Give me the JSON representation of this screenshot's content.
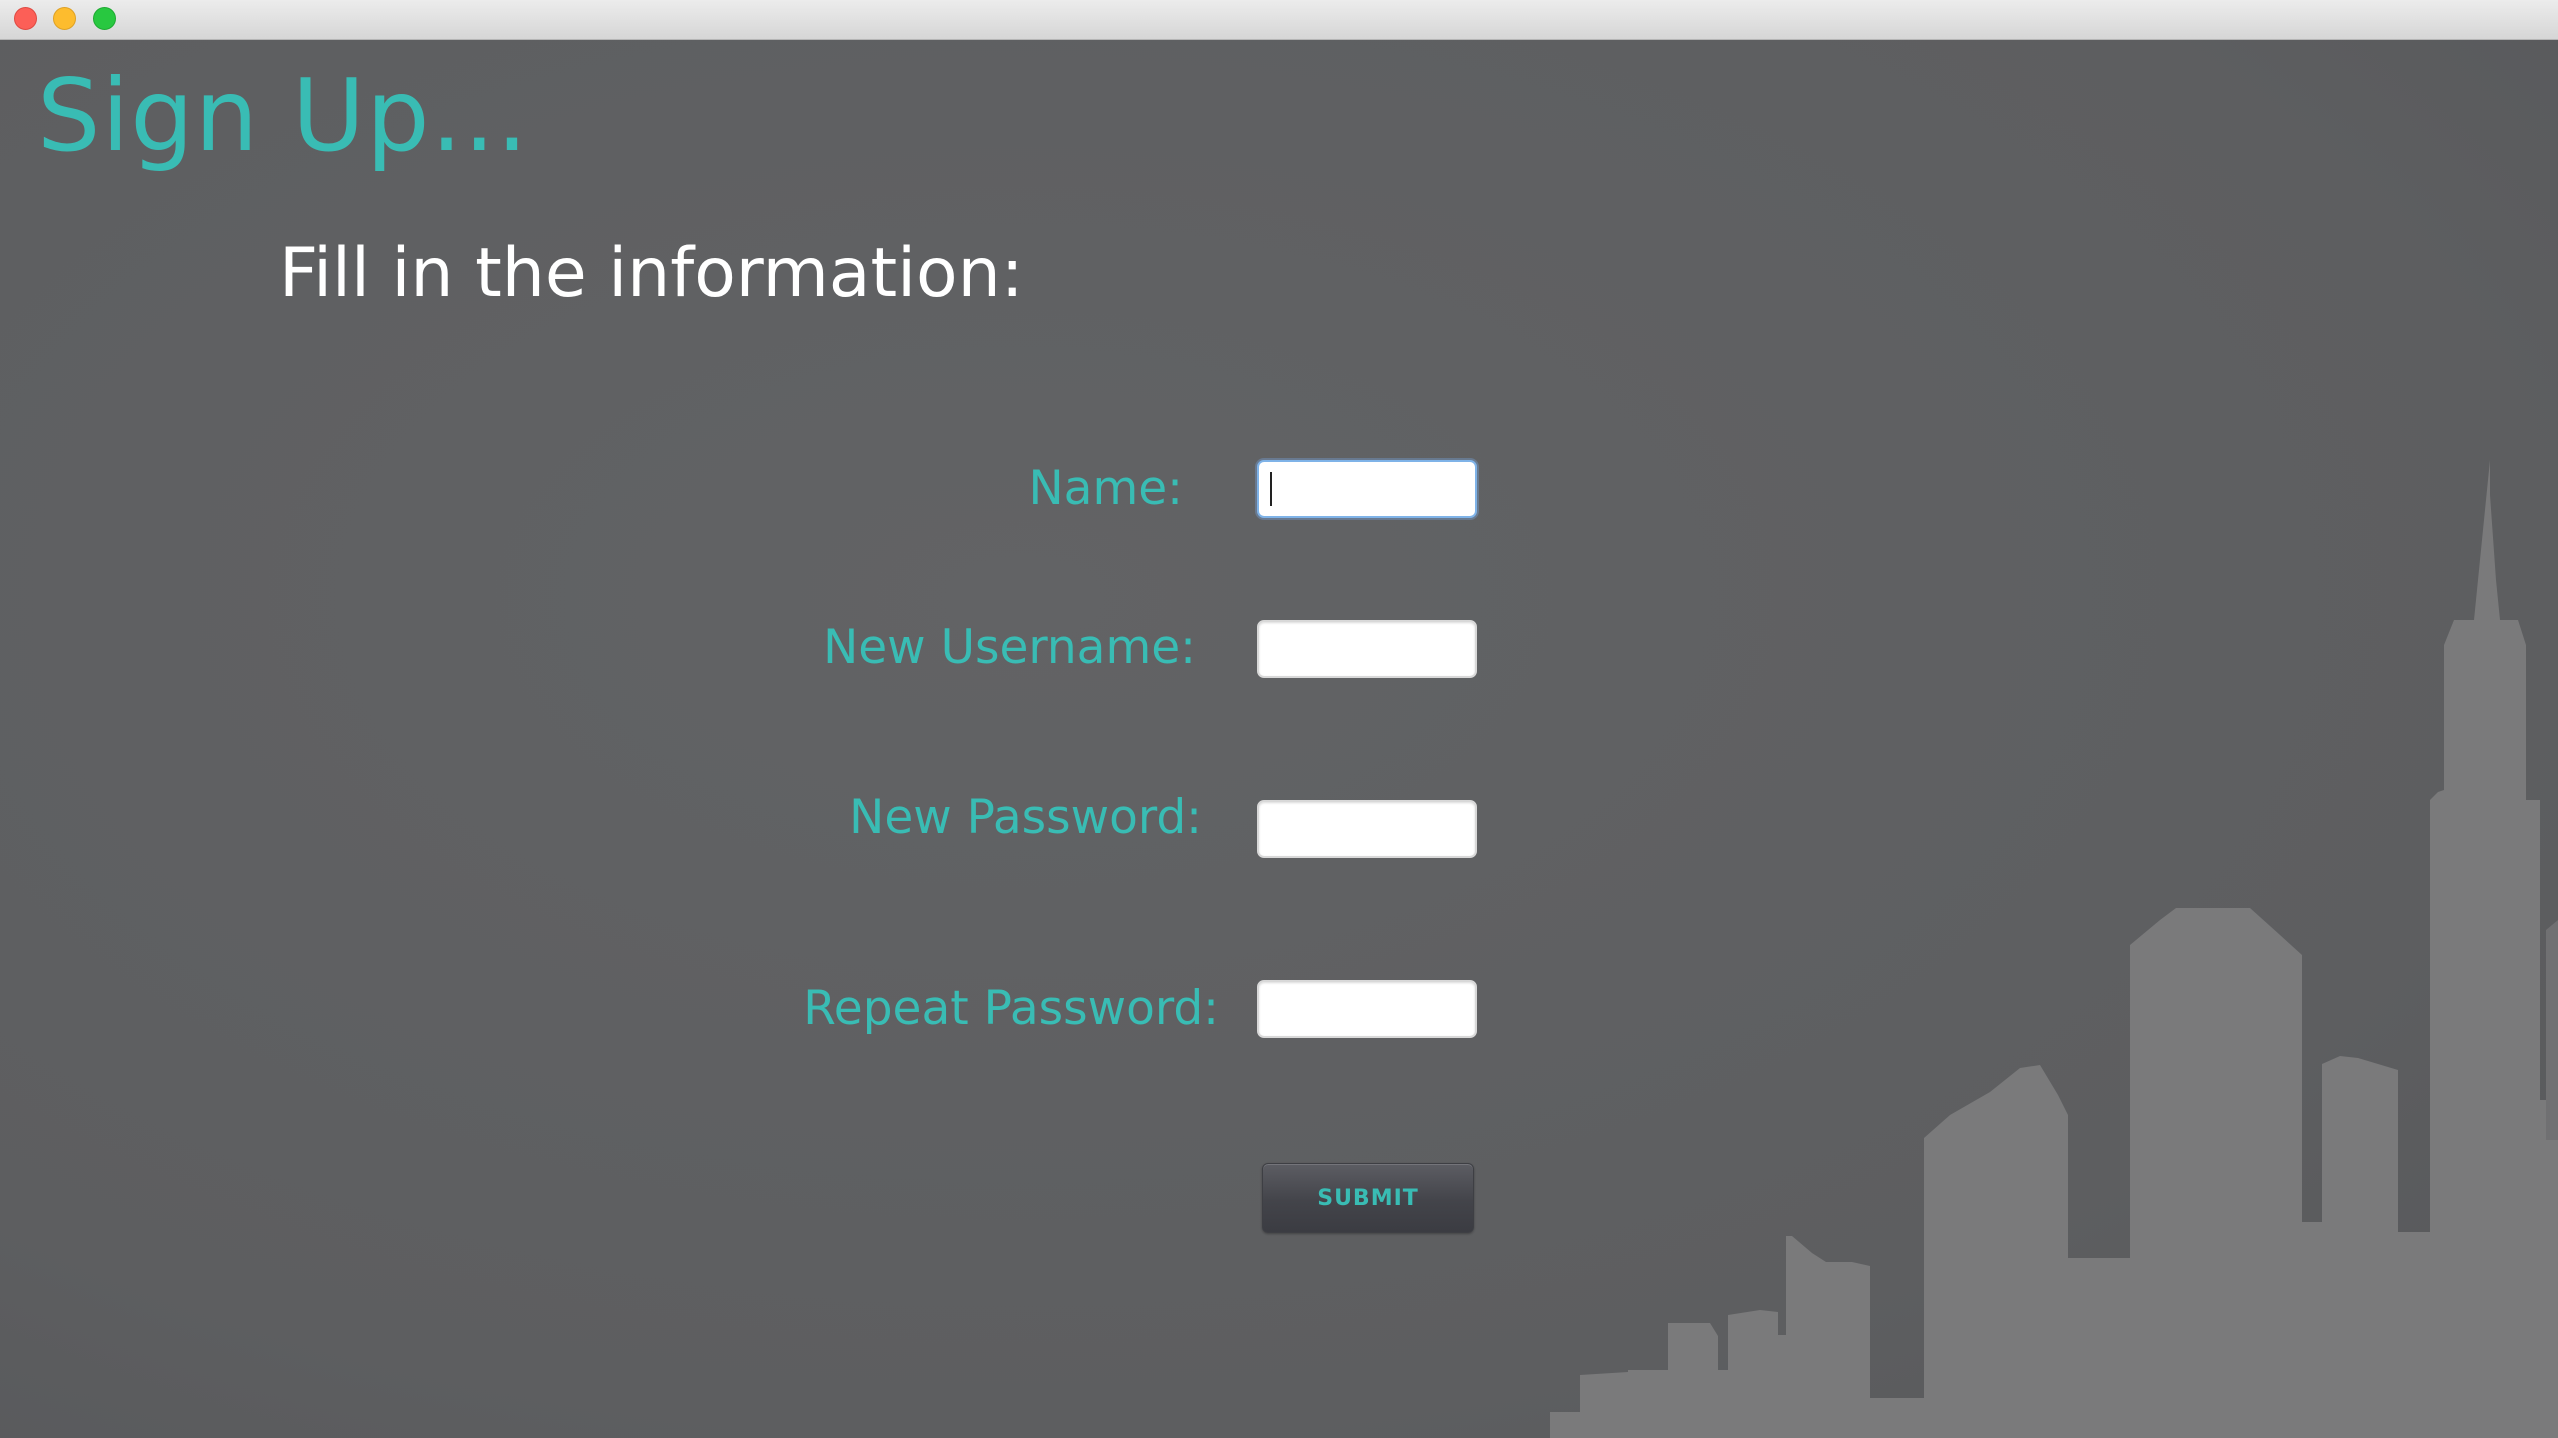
{
  "window": {
    "controls": [
      "close-button",
      "minimize-button",
      "maximize-button"
    ]
  },
  "header": {
    "title": "Sign Up...",
    "subtitle": "Fill in the information:"
  },
  "form": {
    "fields": [
      {
        "label": "Name:",
        "value": "",
        "focused": true
      },
      {
        "label": "New Username:",
        "value": ""
      },
      {
        "label": "New Password:",
        "value": ""
      },
      {
        "label": "Repeat Password:",
        "value": ""
      }
    ],
    "submit_label": "SUBMIT"
  },
  "colors": {
    "accent": "#39bcb4",
    "background": "#5f6062",
    "skyline": "#7a7a7b",
    "heading_text": "#ffffff"
  },
  "decoration": {
    "background_graphic": "city-skyline"
  }
}
